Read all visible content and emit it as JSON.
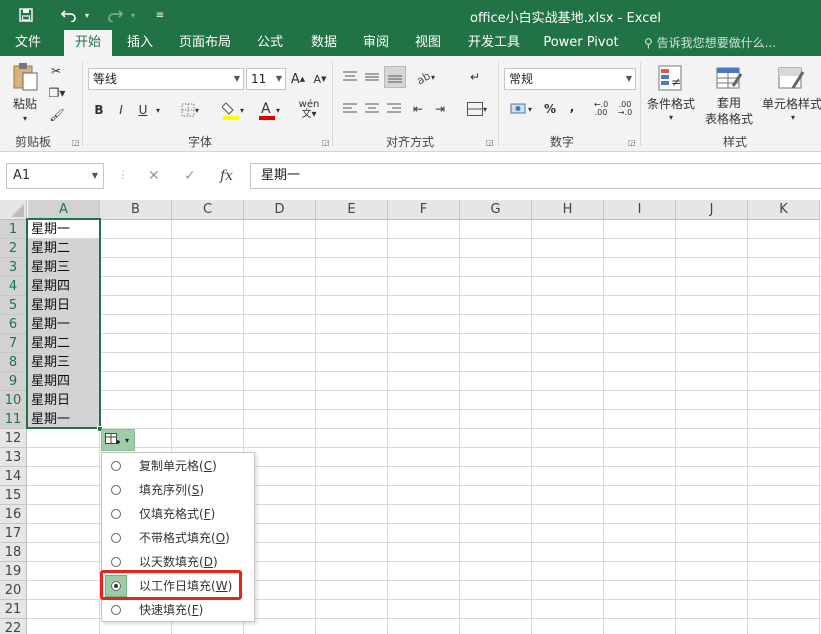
{
  "titlebar": {
    "title": "office小白实战基地.xlsx - Excel",
    "save_icon": "save-icon",
    "undo_icon": "undo-icon",
    "redo_icon": "redo-icon",
    "customize_icon": "customize-qat-icon",
    "bg_color": "#217346"
  },
  "tabs": [
    {
      "label": "文件"
    },
    {
      "label": "开始",
      "active": true
    },
    {
      "label": "插入"
    },
    {
      "label": "页面布局"
    },
    {
      "label": "公式"
    },
    {
      "label": "数据"
    },
    {
      "label": "审阅"
    },
    {
      "label": "视图"
    },
    {
      "label": "开发工具"
    },
    {
      "label": "Power Pivot"
    }
  ],
  "tellme": "告诉我您想要做什么...",
  "ribbon": {
    "clipboard": {
      "paste_label": "粘贴",
      "group_label": "剪贴板"
    },
    "font": {
      "font_name": "等线",
      "font_size": "11",
      "bold": "B",
      "italic": "I",
      "underline": "U",
      "wen": "wén",
      "group_label": "字体"
    },
    "alignment": {
      "group_label": "对齐方式"
    },
    "number": {
      "format": "常规",
      "percent": "%",
      "comma": ",",
      "group_label": "数字"
    },
    "styles": {
      "conditional": "条件格式",
      "table_fmt_1": "套用",
      "table_fmt_2": "表格格式",
      "cell_styles": "单元格样式",
      "group_label": "样式"
    }
  },
  "formula_bar": {
    "name_box": "A1",
    "fx": "fx",
    "content": "星期一"
  },
  "grid": {
    "columns": [
      "A",
      "B",
      "C",
      "D",
      "E",
      "F",
      "G",
      "H",
      "I",
      "J",
      "K"
    ],
    "rows": [
      "1",
      "2",
      "3",
      "4",
      "5",
      "6",
      "7",
      "8",
      "9",
      "10",
      "11",
      "12",
      "13",
      "14",
      "15",
      "16",
      "17",
      "18",
      "19",
      "20",
      "21",
      "22"
    ],
    "col_a_values": [
      "星期一",
      "星期二",
      "星期三",
      "星期四",
      "星期日",
      "星期一",
      "星期二",
      "星期三",
      "星期四",
      "星期日",
      "星期一"
    ]
  },
  "autofill": {
    "options": [
      {
        "label": "复制单元格",
        "key": "C",
        "checked": false
      },
      {
        "label": "填充序列",
        "key": "S",
        "checked": false
      },
      {
        "label": "仅填充格式",
        "key": "F",
        "checked": false
      },
      {
        "label": "不带格式填充",
        "key": "O",
        "checked": false
      },
      {
        "label": "以天数填充",
        "key": "D",
        "checked": false
      },
      {
        "label": "以工作日填充",
        "key": "W",
        "checked": true
      },
      {
        "label": "快速填充",
        "key": "F",
        "checked": false
      }
    ],
    "highlight_color": "#e8231d"
  }
}
